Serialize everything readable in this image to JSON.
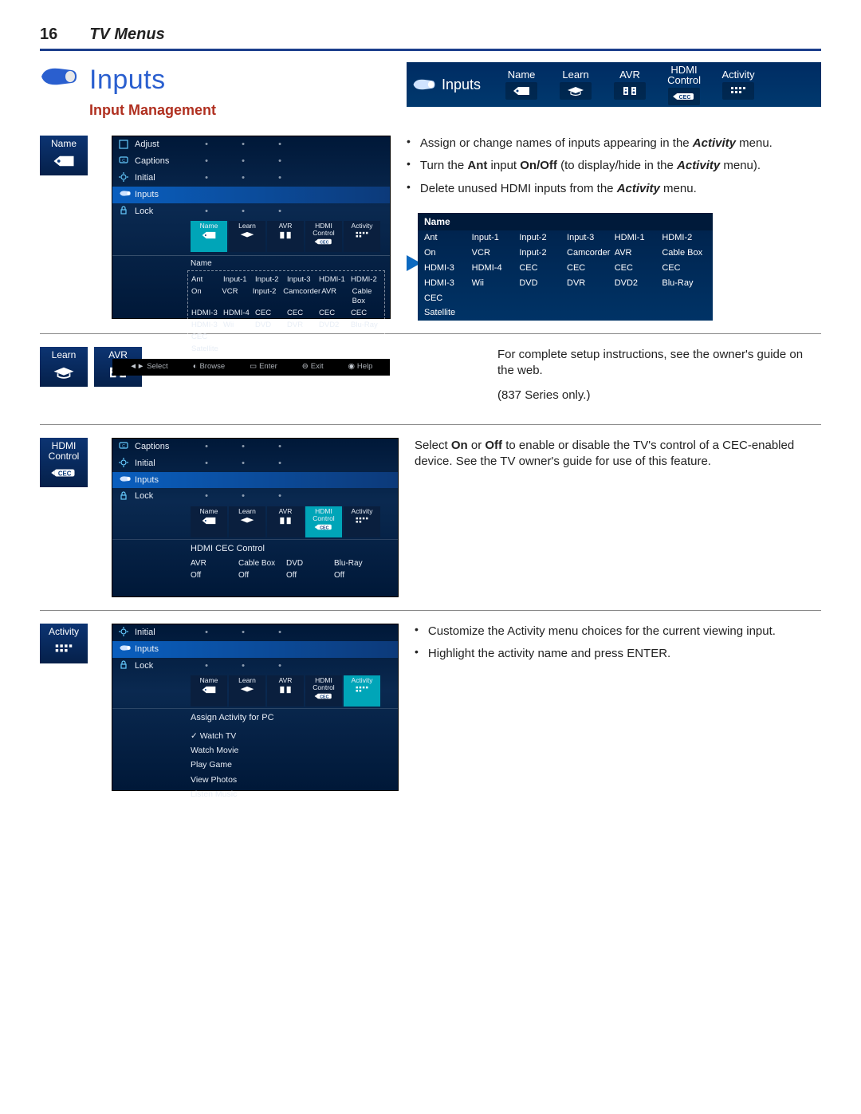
{
  "header": {
    "page_number": "16",
    "section": "TV Menus"
  },
  "title": {
    "main": "Inputs",
    "sub": "Input Management"
  },
  "banner": {
    "inputs": "Inputs",
    "cols": [
      {
        "label": "Name",
        "icon": "tag-icon"
      },
      {
        "label": "Learn",
        "icon": "grad-cap-icon"
      },
      {
        "label": "AVR",
        "icon": "speakers-icon"
      },
      {
        "label": "HDMI\nControl",
        "icon": "cec-icon"
      },
      {
        "label": "Activity",
        "icon": "grid-icon"
      }
    ]
  },
  "side_tiles": {
    "name": {
      "label": "Name",
      "icon": "tag-icon"
    },
    "learn": {
      "label": "Learn",
      "icon": "grad-cap-icon"
    },
    "avr": {
      "label": "AVR",
      "icon": "speakers-icon"
    },
    "hdmi": {
      "label": "HDMI\nControl",
      "icon": "cec-icon"
    },
    "activity": {
      "label": "Activity",
      "icon": "grid-icon"
    }
  },
  "section1": {
    "bullets": [
      "Assign or change names of inputs appearing in the Activity menu.",
      "Turn the Ant input On/Off (to display/hide in the Activity menu).",
      "Delete unused HDMI inputs from the Activity menu."
    ],
    "screen": {
      "side_rows": [
        {
          "icon": "adjust-icon",
          "label": "Adjust"
        },
        {
          "icon": "captions-icon",
          "label": "Captions"
        },
        {
          "icon": "gear-icon",
          "label": "Initial"
        },
        {
          "icon": "plug-icon",
          "label": "Inputs",
          "hl": true
        },
        {
          "icon": "lock-icon",
          "label": "Lock"
        }
      ],
      "head_cells": [
        "Name",
        "Learn",
        "AVR",
        "HDMI\nControl",
        "Activity"
      ],
      "name_table_title": "Name",
      "rows": [
        [
          "Ant",
          "Input-1",
          "Input-2",
          "Input-3",
          "HDMI-1",
          "HDMI-2"
        ],
        [
          "On",
          "VCR",
          "Input-2",
          "Camcorder",
          "AVR",
          "Cable Box"
        ],
        [
          "HDMI-3",
          "HDMI-4",
          "CEC",
          "CEC",
          "CEC",
          "CEC"
        ],
        [
          "HDMI-3",
          "Wii",
          "DVD",
          "DVR",
          "DVD2",
          "Blu-Ray"
        ],
        [
          "CEC",
          "",
          "",
          "",
          "",
          ""
        ],
        [
          "Satellite",
          "",
          "",
          "",
          "",
          ""
        ]
      ],
      "footer": [
        "Select",
        "Browse",
        "Enter",
        "Exit",
        "Help"
      ]
    },
    "callout": {
      "title": "Name",
      "rows": [
        [
          "Ant",
          "Input-1",
          "Input-2",
          "Input-3",
          "HDMI-1",
          "HDMI-2"
        ],
        [
          "On",
          "VCR",
          "Input-2",
          "Camcorder",
          "AVR",
          "Cable Box"
        ],
        [
          "HDMI-3",
          "HDMI-4",
          "CEC",
          "CEC",
          "CEC",
          "CEC"
        ],
        [
          "HDMI-3",
          "Wii",
          "DVD",
          "DVR",
          "DVD2",
          "Blu-Ray"
        ],
        [
          "CEC",
          "",
          "",
          "",
          "",
          ""
        ],
        [
          "Satellite",
          "",
          "",
          "",
          "",
          ""
        ]
      ]
    }
  },
  "section2": {
    "p1": "For complete setup instructions, see the owner's guide on the web.",
    "p2": "(837 Series only.)"
  },
  "section3": {
    "text_pre": "Select ",
    "on": "On",
    "or": " or ",
    "off": "Off",
    "text_post": " to enable or disable the TV's control of a CEC-enabled device.  See the TV owner's guide for use of this feature.",
    "screen": {
      "side_rows": [
        {
          "icon": "captions-icon",
          "label": "Captions"
        },
        {
          "icon": "gear-icon",
          "label": "Initial"
        },
        {
          "icon": "plug-icon",
          "label": "Inputs",
          "hl": true
        },
        {
          "icon": "lock-icon",
          "label": "Lock"
        }
      ],
      "head_cells": [
        "Name",
        "Learn",
        "AVR",
        "HDMI\nControl",
        "Activity"
      ],
      "selected_index": 3,
      "subtitle": "HDMI CEC Control",
      "cec_head": [
        "AVR",
        "Cable Box",
        "DVD",
        "Blu-Ray"
      ],
      "cec_vals": [
        "Off",
        "Off",
        "Off",
        "Off"
      ]
    }
  },
  "section4": {
    "bullets": [
      "Customize the Activity menu choices for the current viewing input.",
      "Highlight the activity name and press ENTER."
    ],
    "screen": {
      "side_rows": [
        {
          "icon": "gear-icon",
          "label": "Initial"
        },
        {
          "icon": "plug-icon",
          "label": "Inputs",
          "hl": true
        },
        {
          "icon": "lock-icon",
          "label": "Lock"
        }
      ],
      "head_cells": [
        "Name",
        "Learn",
        "AVR",
        "HDMI\nControl",
        "Activity"
      ],
      "selected_index": 4,
      "subtitle": "Assign Activity for PC",
      "activities": [
        "Watch TV",
        "Watch Movie",
        "Play Game",
        "View Photos",
        "Listen Music"
      ],
      "selected_activity": 0
    }
  }
}
